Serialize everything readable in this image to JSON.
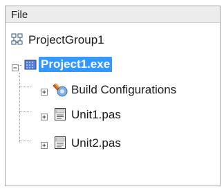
{
  "header": {
    "title": "File"
  },
  "tree": {
    "items": [
      {
        "label": "ProjectGroup1",
        "icon": "project-group-icon",
        "expandable": false,
        "expanded": false,
        "selected": false
      },
      {
        "label": "Project1.exe",
        "icon": "project-exe-icon",
        "expandable": true,
        "expanded": true,
        "selected": true
      },
      {
        "label": "Build Configurations",
        "icon": "build-configurations-icon",
        "expandable": true,
        "expanded": false,
        "selected": false
      },
      {
        "label": "Unit1.pas",
        "icon": "pascal-unit-icon",
        "expandable": true,
        "expanded": false,
        "selected": false
      },
      {
        "label": "Unit2.pas",
        "icon": "pascal-unit-icon",
        "expandable": true,
        "expanded": false,
        "selected": false
      }
    ]
  },
  "colors": {
    "selection": "#3399ff",
    "header_bg": "#ececec",
    "border": "#a7a7a7"
  }
}
